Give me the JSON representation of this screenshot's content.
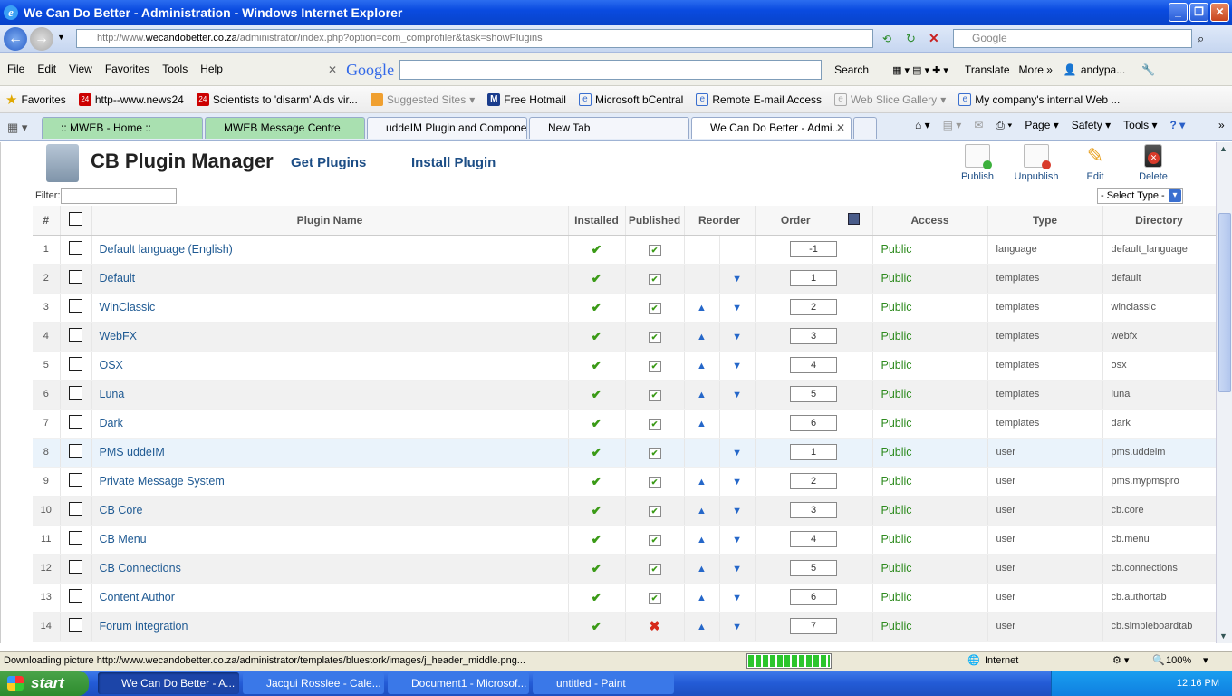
{
  "window": {
    "title": "We Can Do Better - Administration - Windows Internet Explorer"
  },
  "address": {
    "prefix": "http://www.",
    "domain": "wecandobetter.co.za",
    "path": "/administrator/index.php?option=com_comprofiler&task=showPlugins"
  },
  "search_placeholder": "Google",
  "menu": [
    "File",
    "Edit",
    "View",
    "Favorites",
    "Tools",
    "Help"
  ],
  "google_bar": {
    "logo": "Google",
    "search": "Search",
    "translate": "Translate",
    "more": "More »",
    "user": "andypa..."
  },
  "favorites": {
    "label": "Favorites",
    "items": [
      "http--www.news24",
      "Scientists to 'disarm' Aids vir...",
      "Suggested Sites",
      "Free Hotmail",
      "Microsoft bCentral",
      "Remote E-mail Access",
      "Web Slice Gallery",
      "My company's internal Web ..."
    ]
  },
  "tabs": [
    ":: MWEB - Home ::",
    "MWEB Message Centre",
    "uddeIM Plugin and Compone...",
    "New Tab",
    "We Can Do Better - Admi..."
  ],
  "commands": {
    "page": "Page",
    "safety": "Safety",
    "tools": "Tools"
  },
  "page": {
    "title": "CB Plugin Manager",
    "get_plugins": "Get Plugins",
    "install_plugin": "Install Plugin",
    "filter_label": "Filter:",
    "type_select": "- Select Type -"
  },
  "toolbar": {
    "publish": "Publish",
    "unpublish": "Unpublish",
    "edit": "Edit",
    "delete": "Delete"
  },
  "columns": {
    "num": "#",
    "name": "Plugin Name",
    "installed": "Installed",
    "published": "Published",
    "reorder": "Reorder",
    "order": "Order",
    "access": "Access",
    "type": "Type",
    "directory": "Directory"
  },
  "rows": [
    {
      "num": "1",
      "name": "Default language (English)",
      "published": true,
      "up": false,
      "down": false,
      "order": "-1",
      "access": "Public",
      "type": "language",
      "directory": "default_language"
    },
    {
      "num": "2",
      "name": "Default",
      "published": true,
      "up": false,
      "down": true,
      "order": "1",
      "access": "Public",
      "type": "templates",
      "directory": "default"
    },
    {
      "num": "3",
      "name": "WinClassic",
      "published": true,
      "up": true,
      "down": true,
      "order": "2",
      "access": "Public",
      "type": "templates",
      "directory": "winclassic"
    },
    {
      "num": "4",
      "name": "WebFX",
      "published": true,
      "up": true,
      "down": true,
      "order": "3",
      "access": "Public",
      "type": "templates",
      "directory": "webfx"
    },
    {
      "num": "5",
      "name": "OSX",
      "published": true,
      "up": true,
      "down": true,
      "order": "4",
      "access": "Public",
      "type": "templates",
      "directory": "osx"
    },
    {
      "num": "6",
      "name": "Luna",
      "published": true,
      "up": true,
      "down": true,
      "order": "5",
      "access": "Public",
      "type": "templates",
      "directory": "luna"
    },
    {
      "num": "7",
      "name": "Dark",
      "published": true,
      "up": true,
      "down": false,
      "order": "6",
      "access": "Public",
      "type": "templates",
      "directory": "dark"
    },
    {
      "num": "8",
      "name": "PMS uddeIM",
      "published": true,
      "up": false,
      "down": true,
      "order": "1",
      "access": "Public",
      "type": "user",
      "directory": "pms.uddeim"
    },
    {
      "num": "9",
      "name": "Private Message System",
      "published": true,
      "up": true,
      "down": true,
      "order": "2",
      "access": "Public",
      "type": "user",
      "directory": "pms.mypmspro"
    },
    {
      "num": "10",
      "name": "CB Core",
      "published": true,
      "up": true,
      "down": true,
      "order": "3",
      "access": "Public",
      "type": "user",
      "directory": "cb.core"
    },
    {
      "num": "11",
      "name": "CB Menu",
      "published": true,
      "up": true,
      "down": true,
      "order": "4",
      "access": "Public",
      "type": "user",
      "directory": "cb.menu"
    },
    {
      "num": "12",
      "name": "CB Connections",
      "published": true,
      "up": true,
      "down": true,
      "order": "5",
      "access": "Public",
      "type": "user",
      "directory": "cb.connections"
    },
    {
      "num": "13",
      "name": "Content Author",
      "published": true,
      "up": true,
      "down": true,
      "order": "6",
      "access": "Public",
      "type": "user",
      "directory": "cb.authortab"
    },
    {
      "num": "14",
      "name": "Forum integration",
      "published": false,
      "up": true,
      "down": true,
      "order": "7",
      "access": "Public",
      "type": "user",
      "directory": "cb.simpleboardtab"
    }
  ],
  "status": {
    "text": "Downloading picture http://www.wecandobetter.co.za/administrator/templates/bluestork/images/j_header_middle.png...",
    "zone": "Internet",
    "zoom": "100%",
    "progress": 1.0
  },
  "taskbar": {
    "start": "start",
    "items": [
      "We Can Do Better - A...",
      "Jacqui Rosslee - Cale...",
      "Document1 - Microsof...",
      "untitled - Paint"
    ],
    "clock": "12:16 PM"
  },
  "colors": {
    "link": "#1f5a93",
    "access": "#2e8b1f",
    "titlebar": "#0a4be0"
  }
}
